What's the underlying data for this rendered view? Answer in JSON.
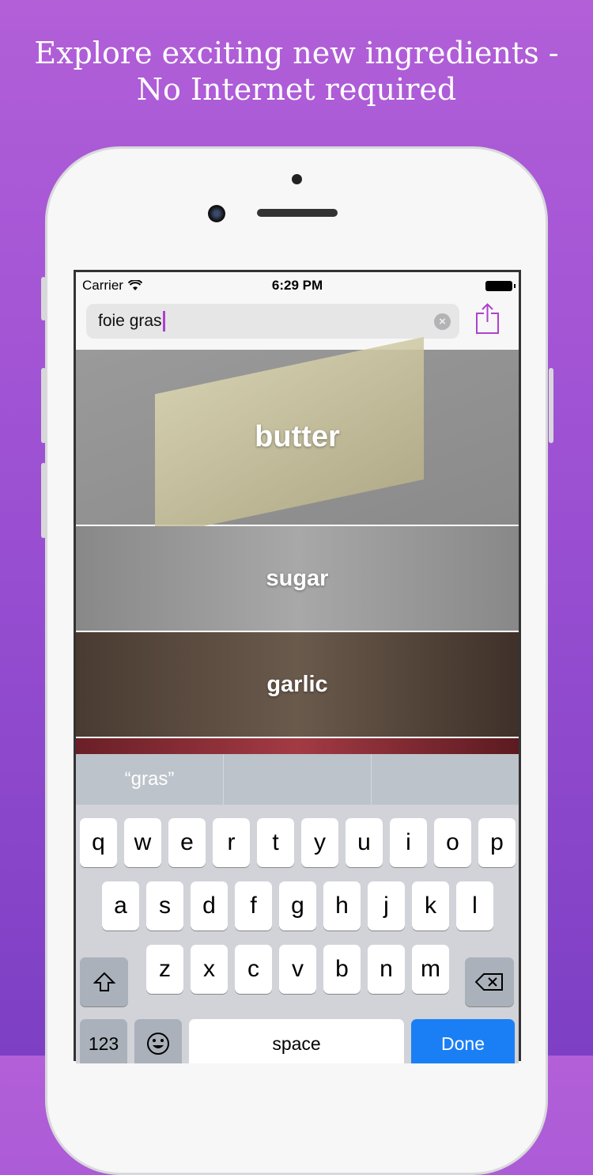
{
  "headline": {
    "line1": "Explore exciting new ingredients -",
    "line2": "No Internet required"
  },
  "status": {
    "carrier": "Carrier",
    "time": "6:29 PM"
  },
  "search": {
    "value": "foie gras"
  },
  "colors": {
    "accent": "#b03fd0",
    "done": "#1a7ff5"
  },
  "results": [
    {
      "label": "butter"
    },
    {
      "label": "sugar"
    },
    {
      "label": "garlic"
    },
    {
      "label": ""
    }
  ],
  "suggestions": [
    "“gras”",
    "",
    ""
  ],
  "keyboard": {
    "row1": [
      "q",
      "w",
      "e",
      "r",
      "t",
      "y",
      "u",
      "i",
      "o",
      "p"
    ],
    "row2": [
      "a",
      "s",
      "d",
      "f",
      "g",
      "h",
      "j",
      "k",
      "l"
    ],
    "row3": [
      "z",
      "x",
      "c",
      "v",
      "b",
      "n",
      "m"
    ],
    "numbers": "123",
    "space": "space",
    "done": "Done"
  }
}
